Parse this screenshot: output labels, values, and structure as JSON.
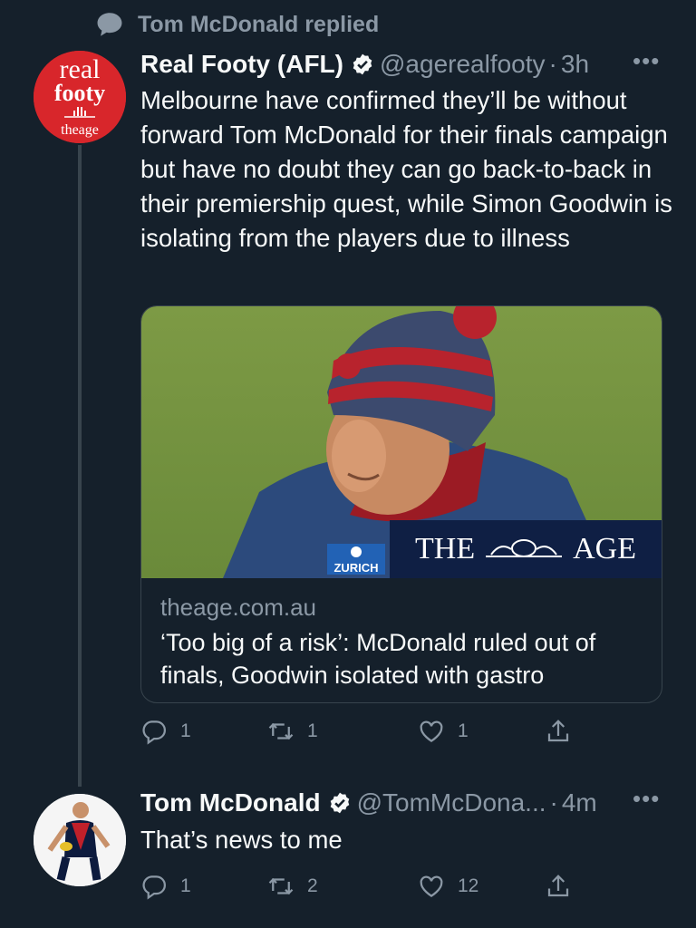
{
  "replied_header": {
    "text": "Tom McDonald replied",
    "icon": "speech-bubble-icon"
  },
  "tweet1": {
    "author": {
      "name": "Real Footy (AFL)",
      "handle": "@agerealfooty",
      "time": "3h",
      "avatar_lines": [
        "real",
        "footy",
        "theage"
      ]
    },
    "text": "Melbourne have confirmed they’ll be without forward Tom McDonald for their finals campaign but have no doubt they can go back-to-back in their premiership quest, while Simon Goodwin is isolating from the players due to illness",
    "card": {
      "domain": "theage.com.au",
      "title": "‘Too big of a risk’: McDonald ruled out of finals, Goodwin isolated with gastro",
      "image_banner_left": "THE",
      "image_banner_right": "AGE",
      "jacket_logo": "ZURICH"
    },
    "actions": {
      "replies": "1",
      "retweets": "1",
      "likes": "1"
    }
  },
  "tweet2": {
    "author": {
      "name": "Tom McDonald",
      "handle": "@TomMcDona...",
      "time": "4m"
    },
    "text": "That’s news to me",
    "actions": {
      "replies": "1",
      "retweets": "2",
      "likes": "12"
    }
  },
  "more_label": "•••",
  "separator": "·",
  "colors": {
    "background": "#15202b",
    "secondary_text": "#8b98a5",
    "primary_text": "#f7f9f9",
    "verified_blue": "#1d9bf0",
    "real_footy_red": "#d8262b"
  }
}
